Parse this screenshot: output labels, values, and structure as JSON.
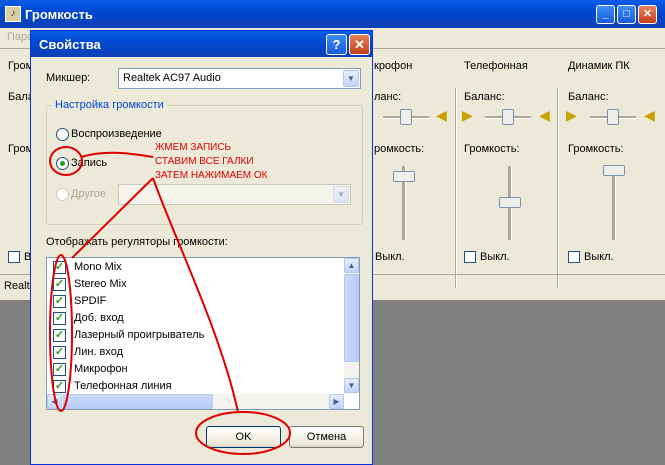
{
  "main_window": {
    "title": "Громкость",
    "menu_fragment": "Пара",
    "columns": [
      {
        "title": "Гром",
        "balance": "Балан",
        "volume": "Гром",
        "mute": "В"
      },
      {
        "title": "крофон",
        "balance": "ланс:",
        "volume": "ромкость:",
        "mute": "Выкл."
      },
      {
        "title": "Телефонная",
        "balance": "Баланс:",
        "volume": "Громкость:",
        "mute": "Выкл."
      },
      {
        "title": "Динамик ПК",
        "balance": "Баланс:",
        "volume": "Громкость:",
        "mute": "Выкл."
      }
    ],
    "status_fragment": "Realte"
  },
  "dialog": {
    "title": "Свойства",
    "mixer_label": "Микшер:",
    "mixer_value": "Realtek AC97 Audio",
    "group_title": "Настройка громкости",
    "radio_playback": "Воспроизведение",
    "radio_record": "Запись",
    "radio_other": "Другое",
    "list_label": "Отображать регуляторы громкости:",
    "list_items": [
      {
        "label": "Mono Mix",
        "checked": true
      },
      {
        "label": "Stereo Mix",
        "checked": true
      },
      {
        "label": "SPDIF",
        "checked": true
      },
      {
        "label": "Доб. вход",
        "checked": true
      },
      {
        "label": "Лазерный проигрыватель",
        "checked": true
      },
      {
        "label": "Лин. вход",
        "checked": true
      },
      {
        "label": "Микрофон",
        "checked": true
      },
      {
        "label": "Телефонная линия",
        "checked": true
      }
    ],
    "ok_label": "OK",
    "cancel_label": "Отмена"
  },
  "annotation": {
    "line1": "ЖМЕМ ЗАПИСЬ",
    "line2": "СТАВИМ ВСЕ ГАЛКИ",
    "line3": "ЗАТЕМ НАЖИМАЕМ ОК",
    "color": "#e00000"
  },
  "colors": {
    "titlebar": "#0a5ce8",
    "window_bg": "#ece9d8",
    "desktop": "#808080"
  },
  "icons": {
    "help": "question-icon",
    "close": "close-icon",
    "speaker": "speaker-icon"
  }
}
